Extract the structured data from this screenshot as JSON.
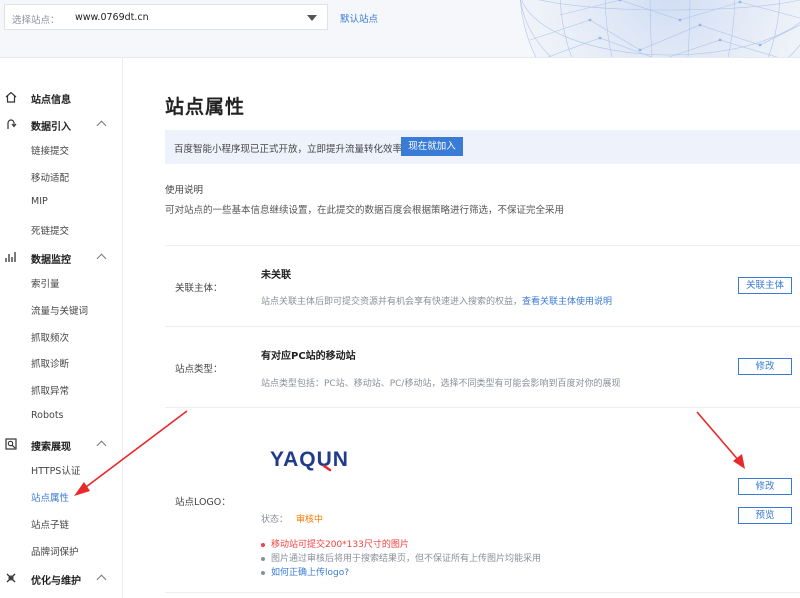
{
  "header": {
    "site_label": "选择站点：",
    "site_value": "www.0769dt.cn",
    "default_site_link": "默认站点"
  },
  "sidebar": {
    "groups": [
      {
        "title": "站点信息",
        "icon": "home-icon",
        "items": []
      },
      {
        "title": "数据引入",
        "icon": "data-import-icon",
        "items": [
          "链接提交",
          "移动适配",
          "MIP",
          "死链提交"
        ]
      },
      {
        "title": "数据监控",
        "icon": "chart-icon",
        "items": [
          "索引量",
          "流量与关键词",
          "抓取频次",
          "抓取诊断",
          "抓取异常",
          "Robots"
        ]
      },
      {
        "title": "搜索展现",
        "icon": "search-display-icon",
        "items": [
          "HTTPS认证",
          "站点属性",
          "站点子链",
          "品牌词保护"
        ]
      },
      {
        "title": "优化与维护",
        "icon": "optimize-icon",
        "items": []
      }
    ],
    "active_item": "站点属性"
  },
  "main": {
    "title": "站点属性",
    "notice": {
      "text": "百度智能小程序现已正式开放，立即提升流量转化效率",
      "button": "现在就加入"
    },
    "usage": {
      "title": "使用说明",
      "desc": "可对站点的一些基本信息继续设置，在此提交的数据百度会根据策略进行筛选，不保证完全采用"
    },
    "rows": {
      "entity": {
        "label": "关联主体：",
        "value": "未关联",
        "desc": "站点关联主体后即可提交资源并有机会享有快速进入搜索的权益，",
        "desc_link": "查看关联主体使用说明",
        "button": "关联主体"
      },
      "type": {
        "label": "站点类型：",
        "value": "有对应PC站的移动站",
        "desc": "站点类型包括：PC站、移动站、PC/移动站，选择不同类型有可能会影响到百度对你的展现",
        "button": "修改"
      },
      "logo": {
        "label": "站点LOGO：",
        "logo_text": "YAQUN",
        "status_label": "状态：",
        "status_value": "审核中",
        "edit_button": "修改",
        "preview_button": "预览",
        "tips": [
          "移动站可提交200*133尺寸的图片",
          "图片通过审核后将用于搜索结果页，但不保证所有上传图片均能采用",
          "如何正确上传logo?"
        ]
      }
    }
  },
  "colors": {
    "accent": "#3a7bd5",
    "warning": "#ff7a00",
    "error": "#f0413e",
    "annotation_arrow": "#e8282b"
  }
}
